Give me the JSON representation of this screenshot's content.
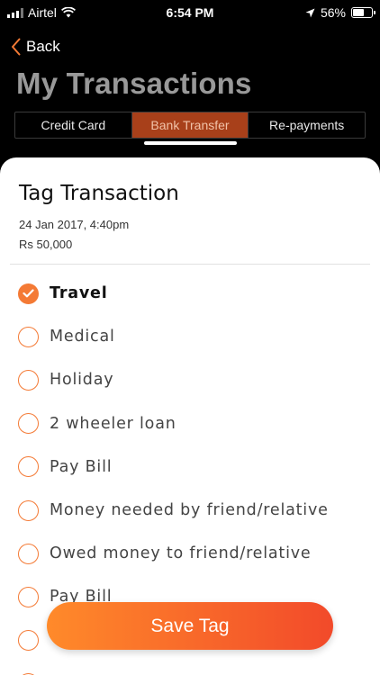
{
  "status_bar": {
    "carrier": "Airtel",
    "time": "6:54 PM",
    "battery": "56%",
    "icons": [
      "signal-icon",
      "wifi-icon",
      "location-arrow-icon",
      "battery-icon"
    ]
  },
  "header": {
    "back_label": "Back",
    "title": "My Transactions",
    "tabs": [
      {
        "label": "Credit Card",
        "active": false
      },
      {
        "label": "Bank Transfer",
        "active": true
      },
      {
        "label": "Re-payments",
        "active": false
      }
    ]
  },
  "sheet": {
    "title": "Tag Transaction",
    "date": "24 Jan 2017, 4:40pm",
    "amount": "Rs 50,000",
    "options": [
      {
        "label": "Travel",
        "selected": true
      },
      {
        "label": "Medical",
        "selected": false
      },
      {
        "label": "Holiday",
        "selected": false
      },
      {
        "label": "2 wheeler loan",
        "selected": false
      },
      {
        "label": "Pay Bill",
        "selected": false
      },
      {
        "label": "Money needed by friend/relative",
        "selected": false
      },
      {
        "label": "Owed money to friend/relative",
        "selected": false
      },
      {
        "label": "Pay Bill",
        "selected": false
      },
      {
        "label": "",
        "selected": false
      },
      {
        "label": "",
        "selected": false
      }
    ],
    "save_label": "Save Tag"
  },
  "colors": {
    "accent": "#f47a35",
    "tab_active": "#a8401a",
    "button_gradient_start": "#ff8a2a",
    "button_gradient_end": "#f24a2a"
  }
}
